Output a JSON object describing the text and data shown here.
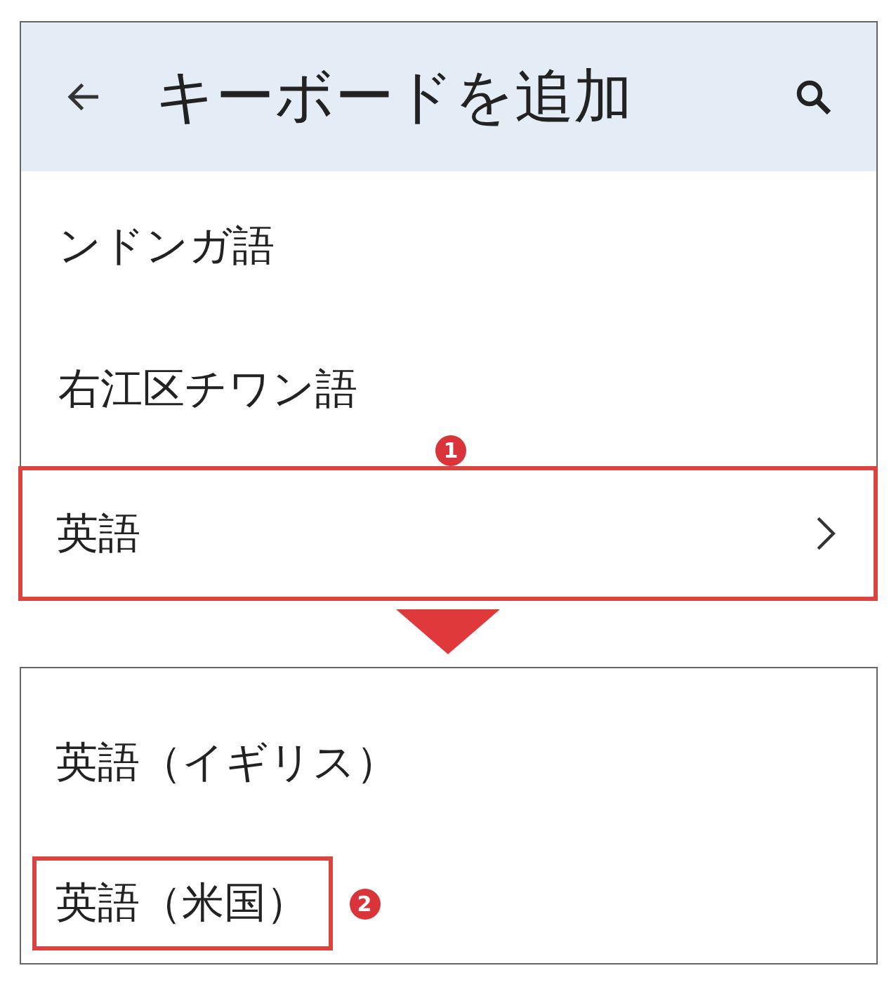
{
  "header": {
    "title": "キーボードを追加"
  },
  "languages": [
    {
      "label": "ンドンガ語",
      "highlighted": false,
      "has_submenu": false
    },
    {
      "label": "右江区チワン語",
      "highlighted": false,
      "has_submenu": false
    },
    {
      "label": "英語",
      "highlighted": true,
      "has_submenu": true,
      "callout": "1"
    }
  ],
  "variants": [
    {
      "label": "英語（イギリス）",
      "highlighted": false
    },
    {
      "label": "英語（米国）",
      "highlighted": true,
      "callout": "2"
    }
  ]
}
